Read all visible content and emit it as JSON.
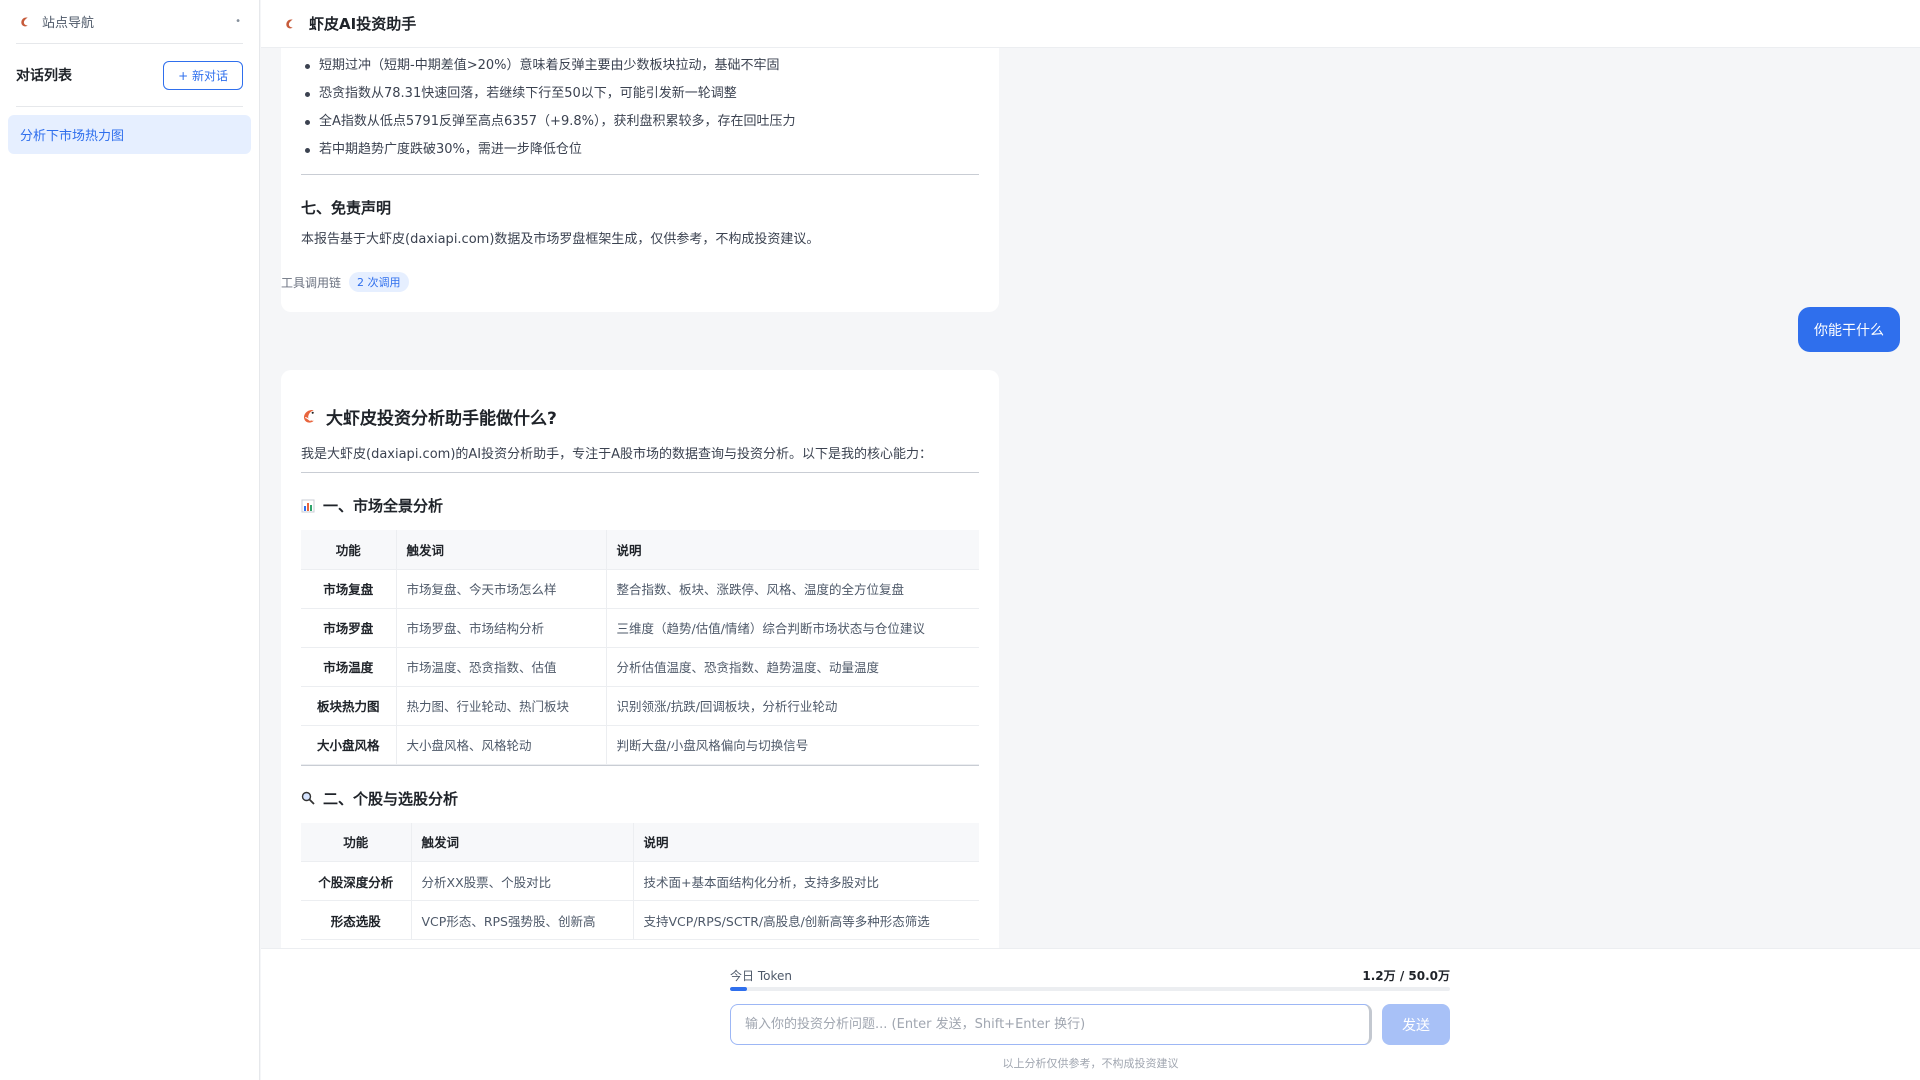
{
  "sidebar": {
    "site_nav_label": "站点导航",
    "conversation_list_title": "对话列表",
    "new_chat_label": "+ 新对话",
    "conversations": [
      {
        "label": "分析下市场热力图"
      }
    ]
  },
  "header": {
    "title": "虾皮AI投资助手"
  },
  "report_tail": {
    "bullets": [
      "短期过冲（短期-中期差值>20%）意味着反弹主要由少数板块拉动，基础不牢固",
      "恐贪指数从78.31快速回落，若继续下行至50以下，可能引发新一轮调整",
      "全A指数从低点5791反弹至高点6357（+9.8%），获利盘积累较多，存在回吐压力",
      "若中期趋势广度跌破30%，需进一步降低仓位"
    ],
    "section_title": "七、免责声明",
    "disclaimer_text": "本报告基于大虾皮(daxiapi.com)数据及市场罗盘框架生成，仅供参考，不构成投资建议。"
  },
  "tool_chain": {
    "label": "工具调用链",
    "badge": "2 次调用"
  },
  "user_message": "你能干什么",
  "assistant_reply": {
    "title": "大虾皮投资分析助手能做什么?",
    "intro": "我是大虾皮(daxiapi.com)的AI投资分析助手，专注于A股市场的数据查询与投资分析。以下是我的核心能力：",
    "section1": {
      "title": "一、市场全景分析",
      "headers": [
        "功能",
        "触发词",
        "说明"
      ],
      "rows": [
        [
          "市场复盘",
          "市场复盘、今天市场怎么样",
          "整合指数、板块、涨跌停、风格、温度的全方位复盘"
        ],
        [
          "市场罗盘",
          "市场罗盘、市场结构分析",
          "三维度（趋势/估值/情绪）综合判断市场状态与仓位建议"
        ],
        [
          "市场温度",
          "市场温度、恐贪指数、估值",
          "分析估值温度、恐贪指数、趋势温度、动量温度"
        ],
        [
          "板块热力图",
          "热力图、行业轮动、热门板块",
          "识别领涨/抗跌/回调板块，分析行业轮动"
        ],
        [
          "大小盘风格",
          "大小盘风格、风格轮动",
          "判断大盘/小盘风格偏向与切换信号"
        ]
      ]
    },
    "section2": {
      "title": "二、个股与选股分析",
      "headers": [
        "功能",
        "触发词",
        "说明"
      ],
      "rows": [
        [
          "个股深度分析",
          "分析XX股票、个股对比",
          "技术面+基本面结构化分析，支持多股对比"
        ],
        [
          "形态选股",
          "VCP形态、RPS强势股、创新高",
          "支持VCP/RPS/SCTR/高股息/创新高等多种形态筛选"
        ]
      ]
    }
  },
  "composer": {
    "token_label": "今日 Token",
    "token_value": "1.2万 / 50.0万",
    "token_fraction": 0.024,
    "placeholder": "输入你的投资分析问题... (Enter 发送，Shift+Enter 换行)",
    "send_label": "发送",
    "footer_note": "以上分析仅供参考，不构成投资建议"
  }
}
